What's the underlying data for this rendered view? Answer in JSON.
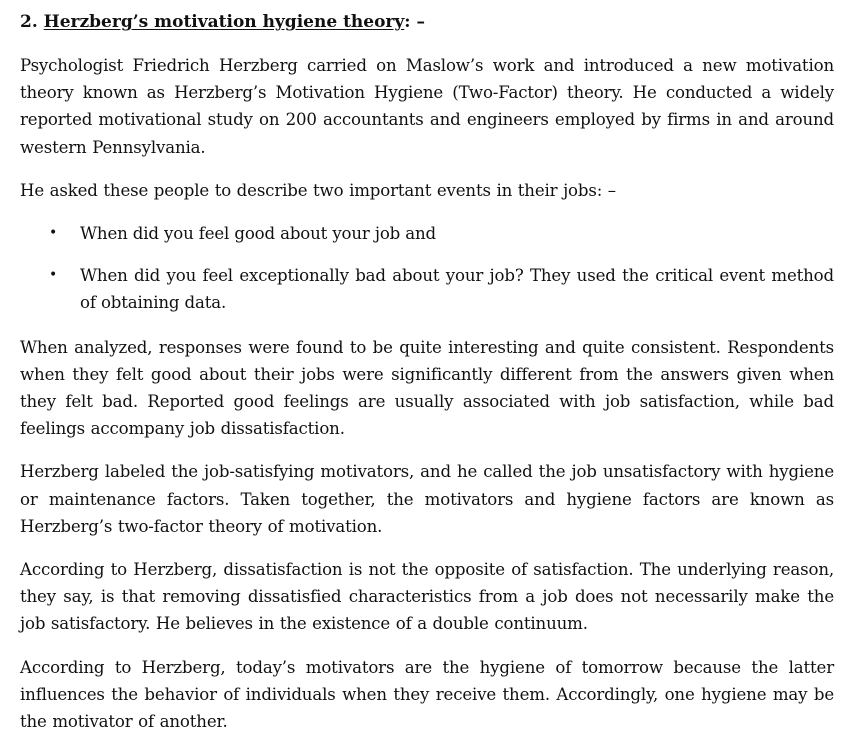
{
  "heading": {
    "number": "2.",
    "title": "Herzberg’s motivation hygiene theory",
    "suffix": ": –"
  },
  "paragraphs": {
    "p1": "Psychologist Friedrich Herzberg carried on Maslow’s work and introduced a new motivation theory known as Herzberg’s Motivation Hygiene (Two-Factor) theory. He conducted a widely reported motivational study on 200 accountants and engineers employed by firms in and around western Pennsylvania.",
    "p2": "He asked these people to describe two important events in their jobs: –",
    "p3": "When analyzed, responses were found to be quite interesting and quite consistent. Respondents when they felt good about their jobs were significantly different from the answers given when they felt bad. Reported good feelings are usually associated with job satisfaction, while bad feelings accompany job dissatisfaction.",
    "p4": "Herzberg labeled the job-satisfying motivators, and he called the job unsatisfactory with hygiene or maintenance factors. Taken together, the motivators and hygiene factors are known as Herzberg’s two-factor theory of motivation.",
    "p5": "According to Herzberg, dissatisfaction is not the opposite of satisfaction. The underlying reason, they say, is that removing dissatisfied characteristics from a job does not necessarily make the job satisfactory. He believes in the existence of a double continuum.",
    "p6": "According to Herzberg, today’s motivators are the hygiene of tomorrow because the latter influences the behavior of individuals when they receive them. Accordingly, one hygiene may be the motivator of another."
  },
  "bullets": [
    "When did you feel good about your job and",
    "When did you feel exceptionally bad about your job? They used the critical event method of obtaining data."
  ],
  "bullet_glyph": "•"
}
